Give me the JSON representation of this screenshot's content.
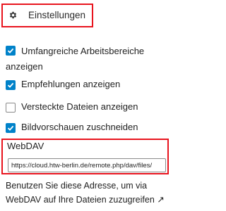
{
  "settings": {
    "title": "Einstellungen",
    "icon": "gear-icon",
    "options": [
      {
        "label": "Umfangreiche Arbeitsbereiche anzeigen",
        "checked": true
      },
      {
        "label": "Empfehlungen anzeigen",
        "checked": true
      },
      {
        "label": "Versteckte Dateien anzeigen",
        "checked": false
      },
      {
        "label": "Bildvorschauen zuschneiden",
        "checked": true
      }
    ]
  },
  "webdav": {
    "label": "WebDAV",
    "value": "https://cloud.htw-berlin.de/remote.php/dav/files/",
    "hint": "Benutzen Sie diese Adresse, um via WebDAV auf Ihre Dateien zuzugreifen ↗"
  },
  "colors": {
    "accent": "#0082c9",
    "highlight": "#e8141e"
  }
}
